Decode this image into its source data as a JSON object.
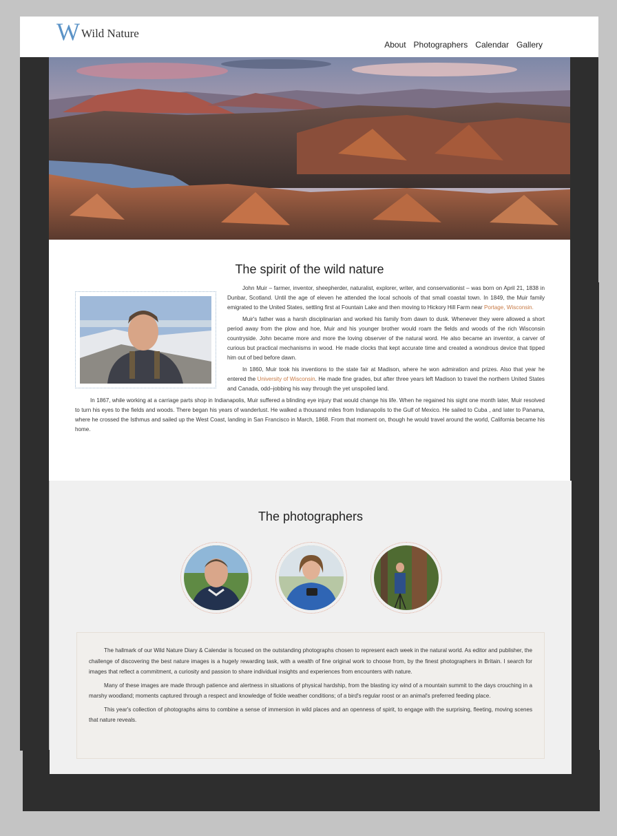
{
  "site": {
    "logo_letter": "W",
    "logo_text": "Wild Nature"
  },
  "nav": [
    {
      "label": "About"
    },
    {
      "label": "Photographers"
    },
    {
      "label": "Calendar"
    },
    {
      "label": "Gallery"
    }
  ],
  "about": {
    "title": "The spirit of the wild nature",
    "p1": "John Muir – farmer, inventor, sheepherder, naturalist, explorer, writer, and conservationist – was born on April 21, 1838 in Dunbar, Scotland. Until the age of eleven he attended the local schools of that small coastal town. In 1849, the Muir family emigrated to the United States, settling first at Fountain Lake and then moving to Hickory Hill Farm near ",
    "p1_link": "Portage, Wisconsin.",
    "p2": "Muir's father was a harsh disciplinarian and worked his family from dawn to dusk. Whenever they were allowed a short period away from the plow and hoe, Muir and his younger brother would roam the fields and woods of the rich Wisconsin countryside. John became more and more the loving observer of the natural word. He also became an inventor, a carver of curious but practical mechanisms in wood. He made clocks that kept accurate time and created a wondrous device that tipped him out of bed before dawn.",
    "p3_before": "In 1860, Muir took his inventions to the state fair at Madison, where he won admiration and prizes. Also that year he entered the ",
    "p3_link": "University of Wisconsin",
    "p3_after": ". He made fine grades, but after three years left Madison to travel the northern United States and Canada, odd–jobbing his way through the yet unspoiled land.",
    "p4": "In 1867, while working at a carriage parts shop in Indianapolis, Muir suffered a blinding eye injury that would change his life. When he regained his sight one month later, Muir resolved to turn his eyes to the fields and woods. There began his years of wanderlust. He walked a thousand miles from Indianapolis to the Gulf of Mexico. He sailed to Cuba , and later to Panama, where he crossed the Isthmus and sailed up the West Coast, landing in San Francisco in March, 1868. From that moment on, though he would travel around the world, California became his home."
  },
  "photographers": {
    "title": "The photographers",
    "p1": "The hallmark of our Wild Nature Diary & Calendar is focused on the outstanding photographs chosen to represent each week in the natural world. As editor and publisher, the challenge of discovering the best nature images is a hugely rewarding task, with a wealth of fine original work to choose from, by the finest photographers in Britain. I search for images that reflect a commitment, a curiosity and passion to share individual insights and experiences from encounters with nature.",
    "p2": "Many of these images are made through patience and alertness in situations of physical hardship, from the blasting icy wind of a mountain summit to the days crouching in a marshy woodland; moments captured through a respect and knowledge of fickle weather conditions; of a bird's regular roost or an animal's preferred feeding place.",
    "p3": "This year's collection of photographs aims to combine a sense of immersion in wild places and an openness of spirit, to engage with the surprising, fleeting, moving scenes that nature reveals."
  },
  "colors": {
    "accent": "#c77a45",
    "logo_blue": "#5b93c7",
    "frame_dark": "#2e2e2e",
    "page_bg": "#c4c4c4"
  }
}
